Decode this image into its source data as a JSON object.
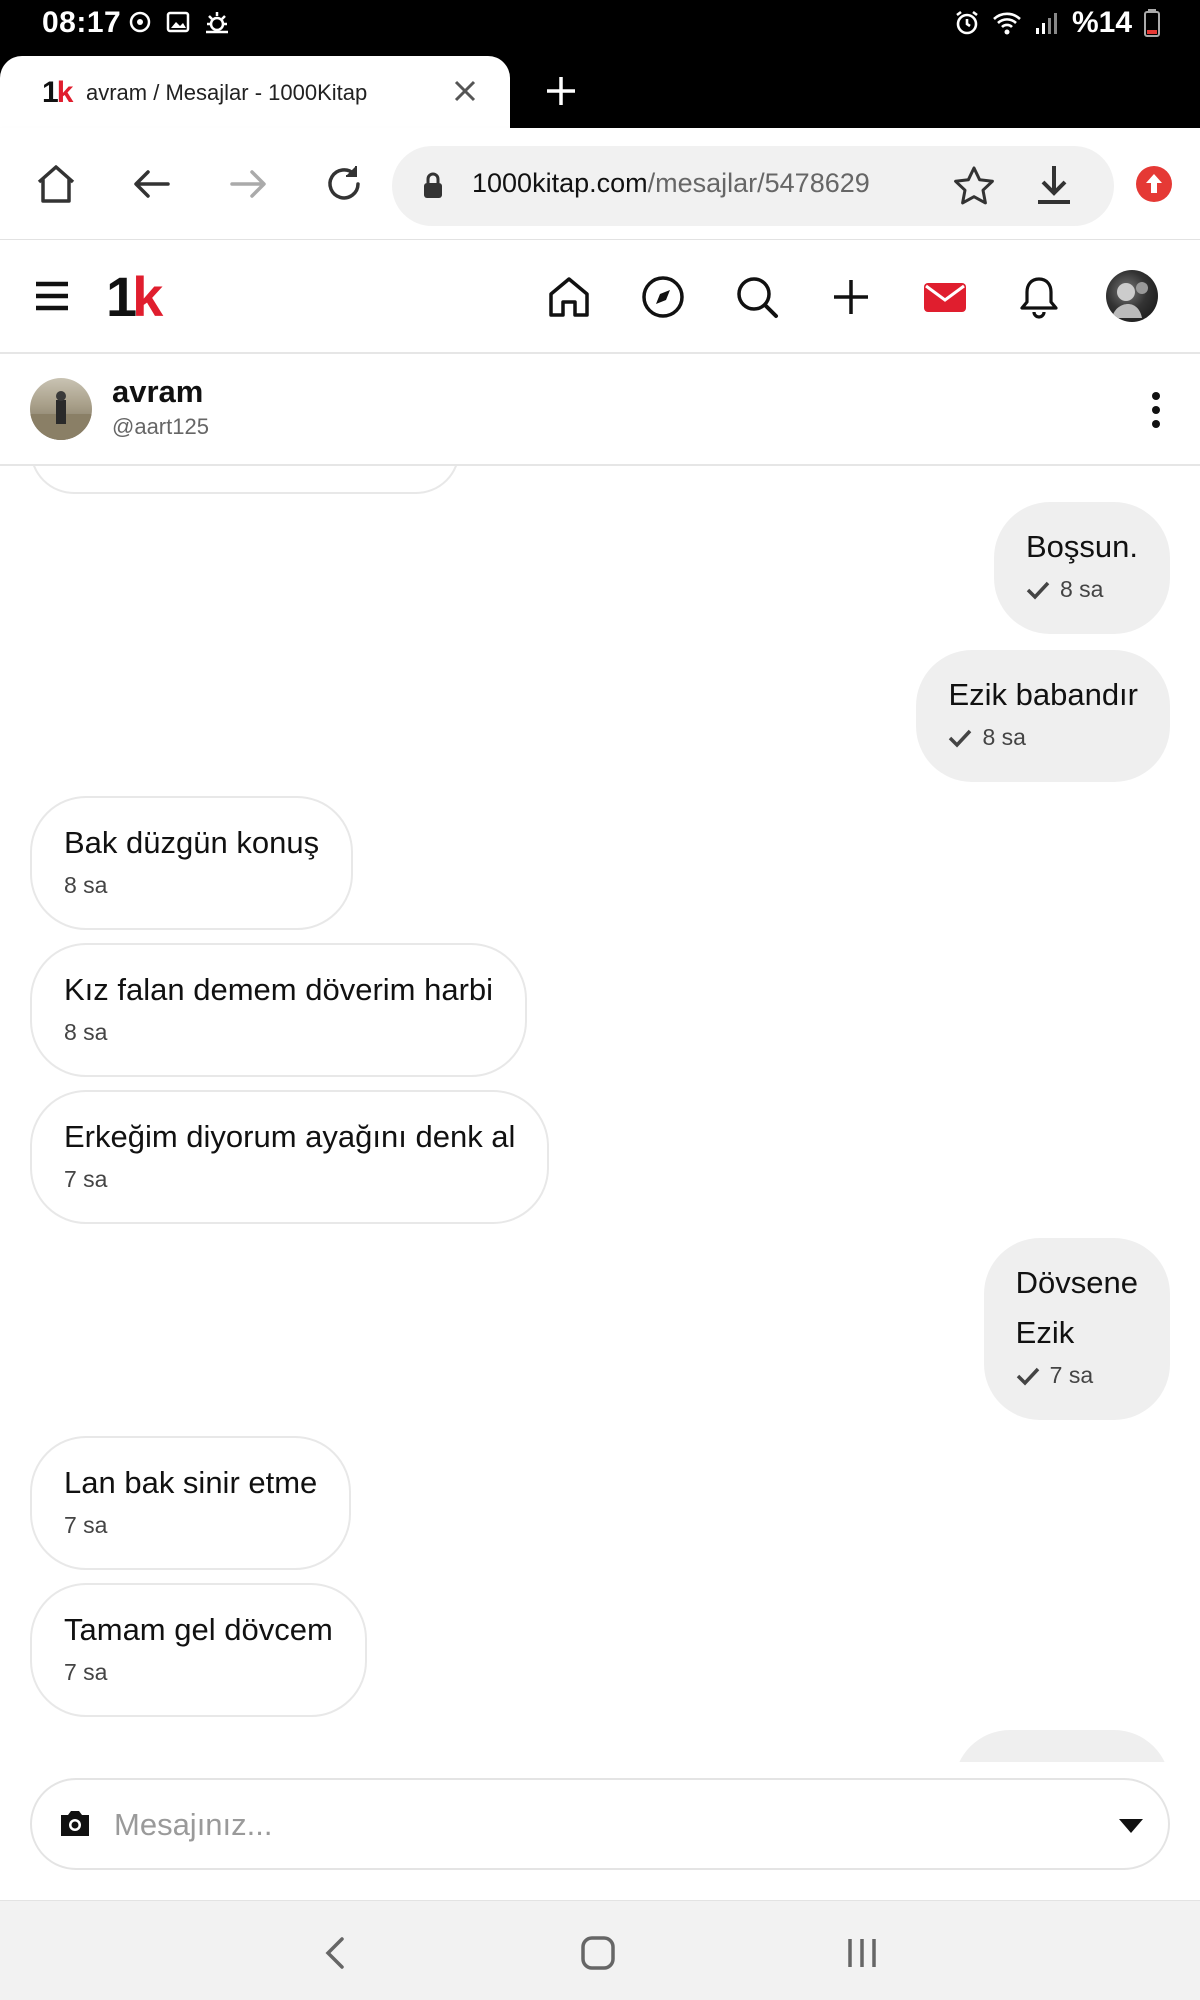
{
  "status_bar": {
    "time": "08:17",
    "battery": "%14",
    "left_icons": [
      "sync-icon",
      "gallery-icon",
      "weather-icon"
    ],
    "right_icons": [
      "alarm-icon",
      "wifi-icon",
      "signal-icon",
      "battery-icon"
    ]
  },
  "browser": {
    "tab": {
      "title": "avram / Mesajlar - 1000Kitap",
      "favicon_one": "1",
      "favicon_k": "k"
    },
    "url": {
      "host": "1000kitap.com",
      "path": "/mesajlar/5478629"
    }
  },
  "app": {
    "logo_one": "1",
    "logo_k": "k",
    "brand_red": "#e01e2e",
    "nav_icons": [
      "home-icon",
      "explore-icon",
      "search-icon",
      "add-icon",
      "mail-icon",
      "bell-icon"
    ]
  },
  "chat": {
    "name": "avram",
    "handle": "@aart125"
  },
  "messages": [
    {
      "direction": "out",
      "lines": [
        "Boşsun."
      ],
      "time": "8 sa",
      "read": true
    },
    {
      "direction": "out",
      "lines": [
        "Ezik babandır"
      ],
      "time": "8 sa",
      "read": true
    },
    {
      "direction": "in",
      "lines": [
        "Bak düzgün konuş"
      ],
      "time": "8 sa"
    },
    {
      "direction": "in",
      "lines": [
        "Kız falan demem döverim harbi"
      ],
      "time": "8 sa"
    },
    {
      "direction": "in",
      "lines": [
        "Erkeğim diyorum ayağını denk al"
      ],
      "time": "7 sa"
    },
    {
      "direction": "out",
      "lines": [
        "Dövsene",
        "Ezik"
      ],
      "time": "7 sa",
      "read": true
    },
    {
      "direction": "in",
      "lines": [
        "Lan bak sinir etme"
      ],
      "time": "7 sa"
    },
    {
      "direction": "in",
      "lines": [
        "Tamam gel dövcem"
      ],
      "time": "7 sa"
    }
  ],
  "composer": {
    "placeholder": "Mesajınız..."
  }
}
